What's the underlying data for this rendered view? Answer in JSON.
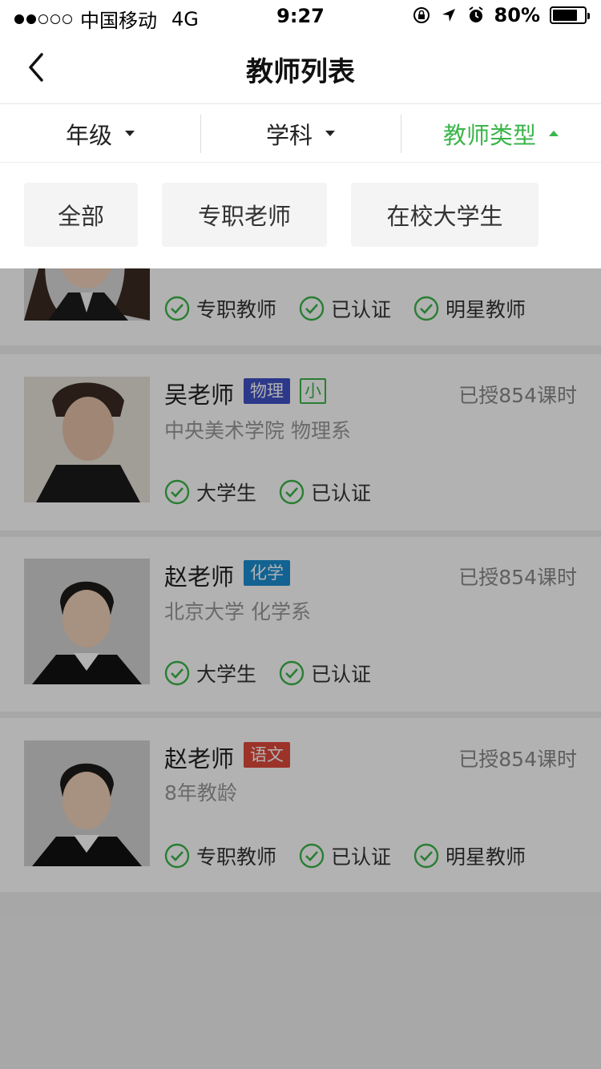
{
  "status_bar": {
    "carrier": "中国移动",
    "network": "4G",
    "time": "9:27",
    "battery": "80%",
    "battery_level": 0.8
  },
  "nav": {
    "title": "教师列表"
  },
  "filters": [
    {
      "label": "年级",
      "active": false
    },
    {
      "label": "学科",
      "active": false
    },
    {
      "label": "教师类型",
      "active": true
    }
  ],
  "type_options": [
    "全部",
    "专职老师",
    "在校大学生"
  ],
  "colors": {
    "accent_green": "#3bb54a",
    "physics_tag": "#3f51c4",
    "chemistry_tag": "#1a8fd1",
    "chinese_tag": "#e0493b"
  },
  "teachers": [
    {
      "name": "",
      "subject": "",
      "hours": "",
      "desc": "",
      "badges": [
        "专职教师",
        "已认证",
        "明星教师"
      ]
    },
    {
      "name": "吴老师",
      "subject": "物理",
      "level": "小",
      "hours": "已授854课时",
      "desc": "中央美术学院   物理系",
      "badges": [
        "大学生",
        "已认证"
      ]
    },
    {
      "name": "赵老师",
      "subject": "化学",
      "hours": "已授854课时",
      "desc": "北京大学 化学系",
      "badges": [
        "大学生",
        "已认证"
      ]
    },
    {
      "name": "赵老师",
      "subject": "语文",
      "hours": "已授854课时",
      "desc": "8年教龄",
      "badges": [
        "专职教师",
        "已认证",
        "明星教师"
      ]
    }
  ]
}
